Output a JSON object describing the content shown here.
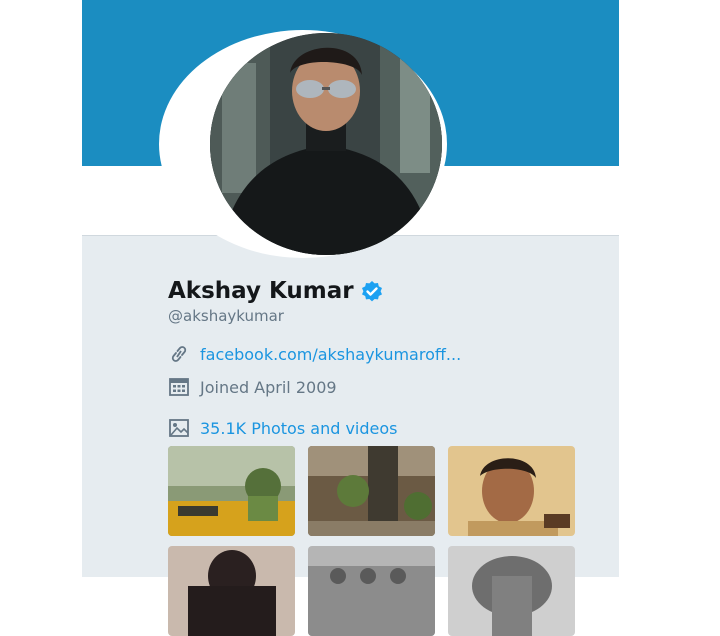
{
  "profile": {
    "name": "Akshay Kumar",
    "handle": "@akshaykumar",
    "website": "facebook.com/akshaykumaroff...",
    "joined": "Joined April 2009",
    "media_count_label": "35.1K Photos and videos"
  },
  "icons": {
    "verified": "verified-badge-icon",
    "link": "link-icon",
    "calendar": "calendar-icon",
    "media": "image-icon"
  },
  "colors": {
    "banner": "#1b8dc1",
    "link": "#1b95e0",
    "muted": "#657786",
    "background": "#e6ecf0"
  }
}
